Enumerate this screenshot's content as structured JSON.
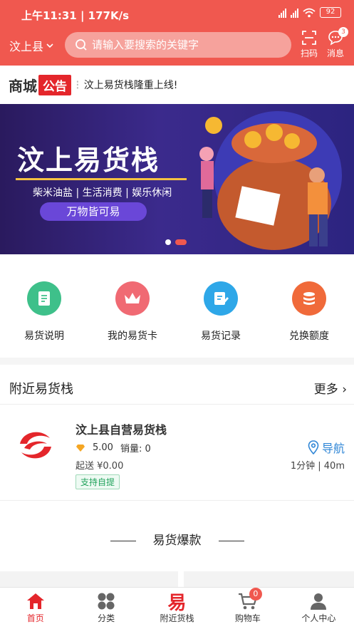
{
  "status_bar": {
    "time": "上午11:31 | 177K/s",
    "battery": "92"
  },
  "header": {
    "location": "汶上县",
    "search_placeholder": "请输入要搜索的关键字",
    "scan_label": "扫码",
    "message_label": "消息",
    "message_count": "3",
    "accent_color": "#f0584f"
  },
  "notice": {
    "shop": "商城",
    "tag": "公告",
    "text": "汶上易货栈隆重上线!"
  },
  "banner": {
    "title": "汶上易货栈",
    "subtitle": "柴米油盐 | 生活消费 | 娱乐休闲",
    "pill": "万物皆可易",
    "page_count": 2,
    "active_index": 1
  },
  "quick_entries": [
    {
      "label": "易货说明",
      "icon": "document-icon",
      "color": "#3ec08a"
    },
    {
      "label": "我的易货卡",
      "icon": "crown-icon",
      "color": "#f06a73"
    },
    {
      "label": "易货记录",
      "icon": "edit-record-icon",
      "color": "#2ea7e8"
    },
    {
      "label": "兑换额度",
      "icon": "coins-icon",
      "color": "#f06a3a"
    }
  ],
  "nearby": {
    "title": "附近易货栈",
    "more": "更多",
    "store": {
      "name": "汶上县自营易货栈",
      "rating": "5.00",
      "sales": "销量: 0",
      "delivery_fee": "起送 ¥0.00",
      "tag": "支持自提",
      "navigate": "导航",
      "distance": "1分钟 | 40m"
    }
  },
  "hot": {
    "title": "易货爆款"
  },
  "tabbar": [
    {
      "label": "首页",
      "icon": "home-icon",
      "active": true
    },
    {
      "label": "分类",
      "icon": "category-icon",
      "active": false
    },
    {
      "label": "附近货栈",
      "icon": "yi-character-icon",
      "glyph": "易",
      "active": false
    },
    {
      "label": "购物车",
      "icon": "cart-icon",
      "badge": "0",
      "active": false
    },
    {
      "label": "个人中心",
      "icon": "user-icon",
      "active": false
    }
  ]
}
